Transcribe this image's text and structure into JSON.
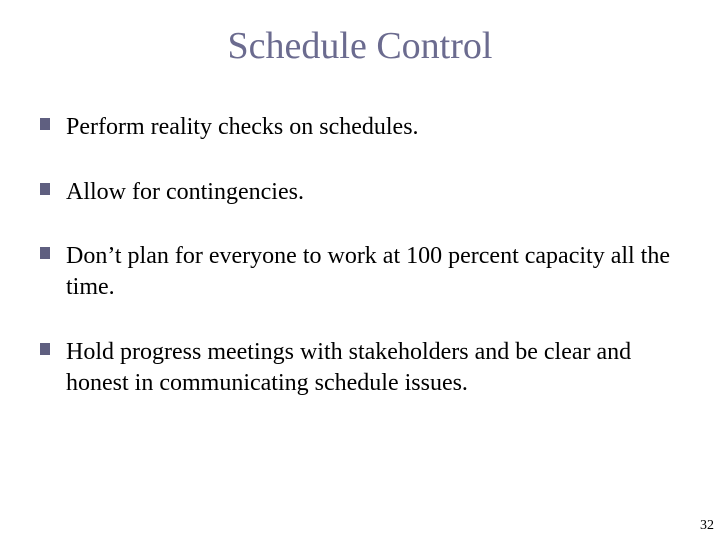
{
  "title": "Schedule Control",
  "bullets": [
    "Perform reality checks on schedules.",
    "Allow for contingencies.",
    "Don’t plan for everyone to work at 100 percent capacity all the time.",
    "Hold progress meetings with stakeholders and be clear and honest in communicating schedule issues."
  ],
  "page_number": "32"
}
